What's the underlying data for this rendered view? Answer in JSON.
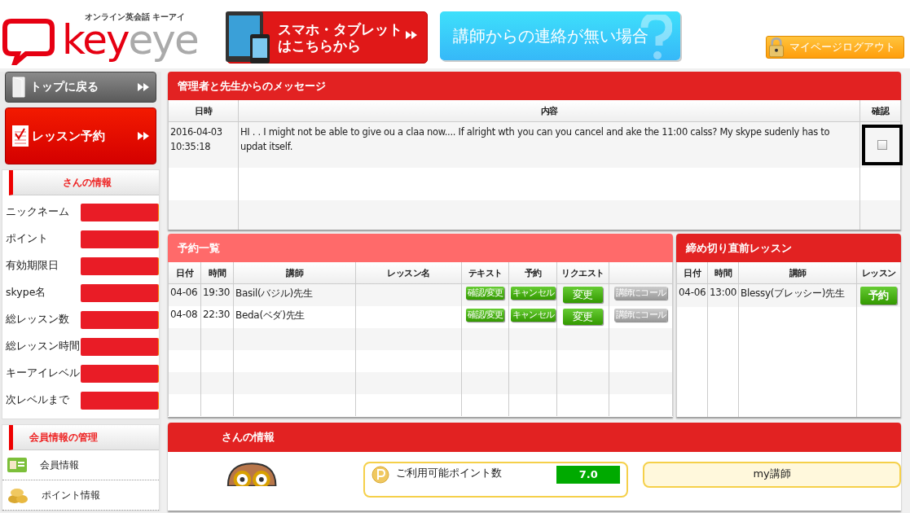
{
  "header": {
    "logo_tagline": "オンライン英会話 キーアイ",
    "logo_key": "key",
    "logo_eye": "eye",
    "smartphone_banner": [
      "スマホ・タブレット",
      "はこちらから"
    ],
    "contact_banner": "講師からの連絡が無い場合",
    "logout": "マイページログアウト"
  },
  "sidebar": {
    "top_button": "トップに戻る",
    "lesson_button": "レッスン予約",
    "info": {
      "title": "さんの情報",
      "rows": [
        "ニックネーム",
        "ポイント",
        "有効期限日",
        "skype名",
        "総レッスン数",
        "総レッスン時間",
        "キーアイレベル",
        "次レベルまで"
      ]
    },
    "member": {
      "title": "会員情報の管理",
      "items": [
        {
          "kind": "card",
          "label": "会員情報"
        },
        {
          "kind": "coins",
          "label": "ポイント情報"
        }
      ]
    }
  },
  "messages": {
    "title": "管理者と先生からのメッセージ",
    "columns": [
      "日時",
      "内容",
      "確認"
    ],
    "rows": [
      {
        "date": "2016-04-03",
        "time": "10:35:18",
        "content": "HI . . I might not be able to give ou  a claa now.... If alright wth you can you  cancel and ake the 11:00 calss? My skype sudenly has to updat itself.",
        "checked": false,
        "highlighted": true
      }
    ]
  },
  "reservations": {
    "title": "予約一覧",
    "columns": [
      "日付",
      "時間",
      "講師",
      "レッスン名",
      "テキスト",
      "予約",
      "リクエスト"
    ],
    "rows": [
      {
        "date": "04-06",
        "time": "19:30",
        "teacher": "Basil(バジル)先生",
        "text_button": "確認/変更",
        "cancel_button": "キャンセル",
        "change_button": "変更",
        "call_button": "講師にコール",
        "call_disabled": true
      },
      {
        "date": "04-08",
        "time": "22:30",
        "teacher": "Beda(ベダ)先生",
        "text_button": "確認/変更",
        "cancel_button": "キャンセル",
        "change_button": "変更",
        "call_button": "講師にコール",
        "call_disabled": true
      }
    ]
  },
  "deadline": {
    "title": "締め切り直前レッスン",
    "columns": [
      "日付",
      "時間",
      "講師",
      "レッスン"
    ],
    "rows": [
      {
        "date": "04-06",
        "time": "13:00",
        "teacher": "Blessy(ブレッシー)先生",
        "button": "予約"
      }
    ]
  },
  "profile": {
    "title": "さんの情報",
    "points_label": "ご利用可能ポイント数",
    "points_value": "7.0",
    "my_teacher": "my講師"
  }
}
